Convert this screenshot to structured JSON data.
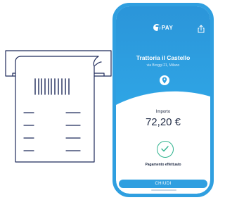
{
  "illustration": {
    "icon": "receipt-printer-icon"
  },
  "app": {
    "brand_label": "PAY",
    "share_icon": "share-icon"
  },
  "merchant": {
    "name": "Trattoria il Castello",
    "address": "via Broggi 21, Milano",
    "icon": "location-pin-icon"
  },
  "payment": {
    "amount_label": "Importo",
    "amount_value": "72,20 €",
    "status_label": "Pagamento effettuato",
    "status_icon": "checkmark-icon"
  },
  "actions": {
    "close_label": "CHIUDI"
  },
  "colors": {
    "primary": "#2f9fe0",
    "success": "#2fb38e",
    "text": "#1f2a44",
    "outline": "#1f2a5a"
  }
}
